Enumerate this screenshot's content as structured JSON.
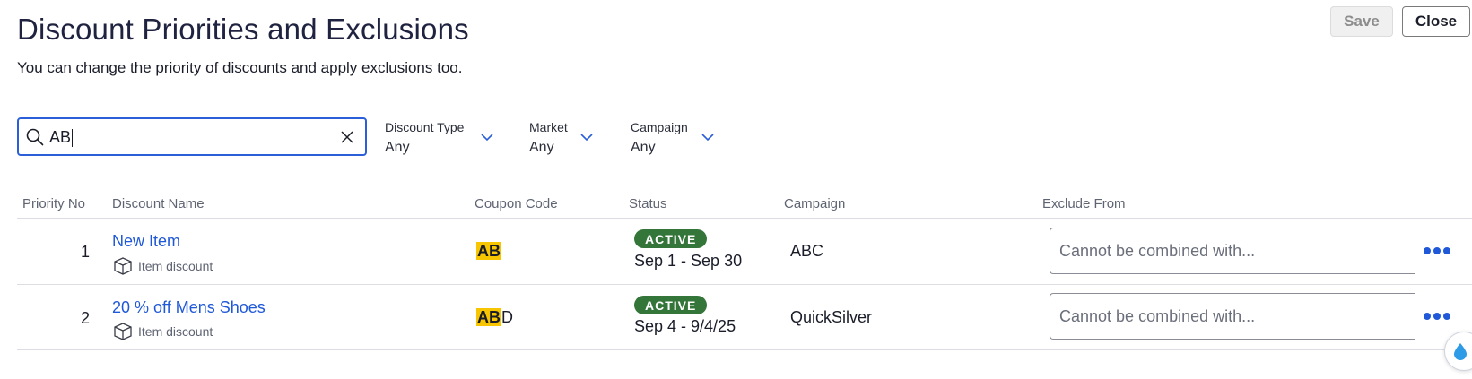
{
  "header": {
    "title": "Discount Priorities and Exclusions",
    "subtitle": "You can change the priority of discounts and apply exclusions too.",
    "save_label": "Save",
    "close_label": "Close"
  },
  "search": {
    "value": "AB",
    "icon": "search-icon",
    "clear_icon": "close-icon"
  },
  "filters": [
    {
      "label": "Discount Type",
      "value": "Any"
    },
    {
      "label": "Market",
      "value": "Any"
    },
    {
      "label": "Campaign",
      "value": "Any"
    }
  ],
  "table": {
    "columns": [
      "Priority No",
      "Discount Name",
      "Coupon Code",
      "Status",
      "Campaign",
      "Exclude From"
    ],
    "rows": [
      {
        "priority": "1",
        "name": "New Item",
        "type": "Item discount",
        "coupon_highlight": "AB",
        "coupon_rest": "",
        "status": "ACTIVE",
        "dates": "Sep 1  - Sep 30",
        "campaign": "ABC",
        "exclude_placeholder": "Cannot be combined with..."
      },
      {
        "priority": "2",
        "name": "20 % off Mens Shoes",
        "type": "Item discount",
        "coupon_highlight": "AB",
        "coupon_rest": "D",
        "status": "ACTIVE",
        "dates": "Sep 4  - 9/4/25",
        "campaign": "QuickSilver",
        "exclude_placeholder": "Cannot be combined with..."
      }
    ]
  },
  "colors": {
    "link": "#1f58d8",
    "active_badge": "#34753a",
    "highlight": "#f7c600",
    "focus_border": "#2b5fd9"
  }
}
